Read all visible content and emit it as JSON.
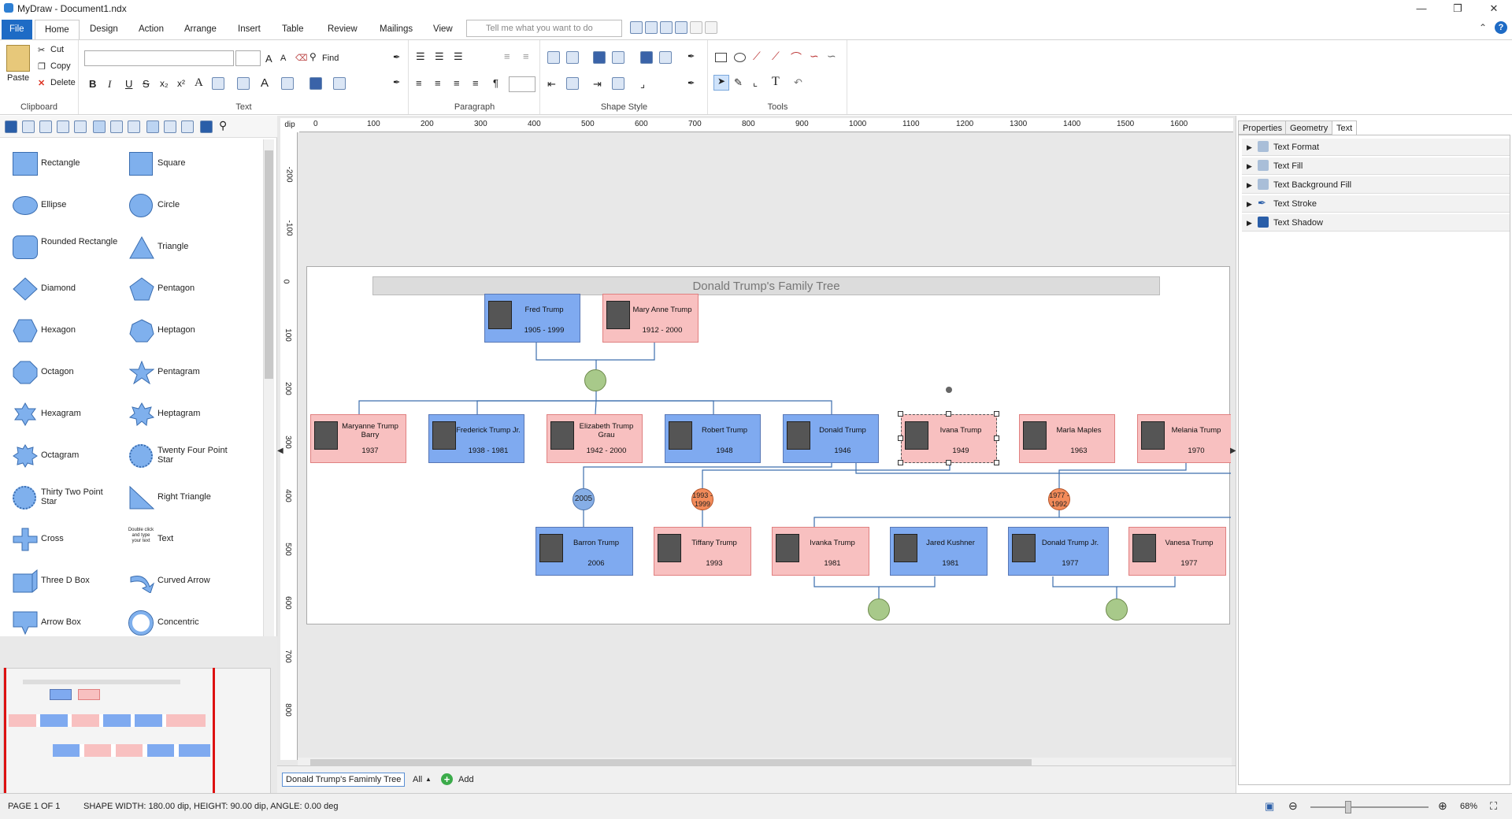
{
  "window": {
    "title": "MyDraw - Document1.ndx"
  },
  "menu": {
    "tabs": [
      "File",
      "Home",
      "Design",
      "Action",
      "Arrange",
      "Insert",
      "Table",
      "Review",
      "Mailings",
      "View"
    ],
    "search_placeholder": "Tell me what you want to do"
  },
  "ribbon": {
    "clipboard": {
      "label": "Clipboard",
      "paste": "Paste",
      "cut": "Cut",
      "copy": "Copy",
      "delete": "Delete"
    },
    "text": {
      "label": "Text",
      "find": "Find"
    },
    "paragraph": {
      "label": "Paragraph"
    },
    "shape_style": {
      "label": "Shape Style"
    },
    "tools": {
      "label": "Tools"
    }
  },
  "shapes": [
    "Rectangle",
    "Square",
    "Ellipse",
    "Circle",
    "Rounded Rectangle",
    "Triangle",
    "Diamond",
    "Pentagon",
    "Hexagon",
    "Heptagon",
    "Octagon",
    "Pentagram",
    "Hexagram",
    "Heptagram",
    "Octagram",
    "Twenty Four Point Star",
    "Thirty Two Point Star",
    "Right Triangle",
    "Cross",
    "Text",
    "Three D Box",
    "Curved Arrow",
    "Arrow Box",
    "Concentric"
  ],
  "text_shape_preview": "Double click and type your text",
  "ruler": {
    "unit": "dip",
    "h_ticks": [
      "0",
      "100",
      "200",
      "300",
      "400",
      "500",
      "600",
      "700",
      "800",
      "900",
      "1000",
      "1100",
      "1200",
      "1300",
      "1400",
      "1500",
      "1600"
    ],
    "v_ticks": [
      "-200",
      "-100",
      "0",
      "100",
      "200",
      "300",
      "400",
      "500",
      "600",
      "700",
      "800"
    ]
  },
  "diagram": {
    "title": "Donald Trump's Family Tree",
    "people": [
      {
        "name": "Fred Trump",
        "years": "1905 - 1999",
        "sex": "m"
      },
      {
        "name": "Mary Anne Trump",
        "years": "1912 - 2000",
        "sex": "f"
      },
      {
        "name": "Maryanne Trump Barry",
        "years": "1937",
        "sex": "f"
      },
      {
        "name": "Frederick Trump Jr.",
        "years": "1938 - 1981",
        "sex": "m"
      },
      {
        "name": "Elizabeth Trump Grau",
        "years": "1942 - 2000",
        "sex": "f"
      },
      {
        "name": "Robert Trump",
        "years": "1948",
        "sex": "m"
      },
      {
        "name": "Donald Trump",
        "years": "1946",
        "sex": "m"
      },
      {
        "name": "Ivana Trump",
        "years": "1949",
        "sex": "f"
      },
      {
        "name": "Marla Maples",
        "years": "1963",
        "sex": "f"
      },
      {
        "name": "Melania Trump",
        "years": "1970",
        "sex": "f"
      },
      {
        "name": "Barron Trump",
        "years": "2006",
        "sex": "m"
      },
      {
        "name": "Tiffany Trump",
        "years": "1993",
        "sex": "f"
      },
      {
        "name": "Ivanka Trump",
        "years": "1981",
        "sex": "f"
      },
      {
        "name": "Jared Kushner",
        "years": "1981",
        "sex": "m"
      },
      {
        "name": "Donald Trump Jr.",
        "years": "1977",
        "sex": "m"
      },
      {
        "name": "Vanesa Trump",
        "years": "1977",
        "sex": "f"
      }
    ],
    "marriages": [
      {
        "label": "2005",
        "style": "blue"
      },
      {
        "label": "1993 - 1999",
        "style": "orange"
      },
      {
        "label": "1977 - 1992",
        "style": "orange"
      }
    ]
  },
  "right_panel": {
    "tabs": [
      "Properties",
      "Geometry",
      "Text"
    ],
    "rows": [
      "Text Format",
      "Text Fill",
      "Text Background Fill",
      "Text Stroke",
      "Text Shadow"
    ]
  },
  "page_tabs": {
    "current": "Donald Trump's Famimly Tree",
    "all": "All",
    "add": "Add"
  },
  "status": {
    "page": "PAGE 1 OF 1",
    "shape": "SHAPE WIDTH: 180.00 dip, HEIGHT: 90.00 dip, ANGLE: 0.00 deg",
    "zoom": "68%"
  }
}
